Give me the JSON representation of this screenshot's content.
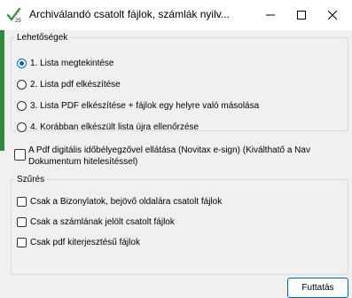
{
  "window": {
    "title": "Archiválandó csatolt fájlok, számlák nyilv...",
    "icon": "check-25-icon"
  },
  "options_group": {
    "legend": "Lehetőségek",
    "items": [
      {
        "label": "1. Lista megtekintése",
        "checked": true
      },
      {
        "label": "2. Lista pdf elkészítése",
        "checked": false
      },
      {
        "label": "3. Lista PDF elkészítése + fájlok egy helyre való másolása",
        "checked": false
      },
      {
        "label": "4. Korábban elkészült lista újra ellenőrzése",
        "checked": false
      }
    ]
  },
  "timestamp_option": {
    "label": "A Pdf digitális időbélyegzővel ellátása (Novitax e-sign) (Kiválthatő a Nav Dokumentum hitelesítéssel)",
    "checked": false
  },
  "filter_group": {
    "legend": "Szűrés",
    "items": [
      {
        "label": "Csak a Bizonylatok, bejövő oldalára csatolt fájlok",
        "checked": false
      },
      {
        "label": "Csak a számlának jelölt csatolt fájlok",
        "checked": false
      },
      {
        "label": "Csak pdf kiterjesztésű fájlok",
        "checked": false
      }
    ]
  },
  "actions": {
    "run_label": "Futtatás"
  },
  "colors": {
    "accent": "#0067c0",
    "background": "#f0f0f0"
  }
}
